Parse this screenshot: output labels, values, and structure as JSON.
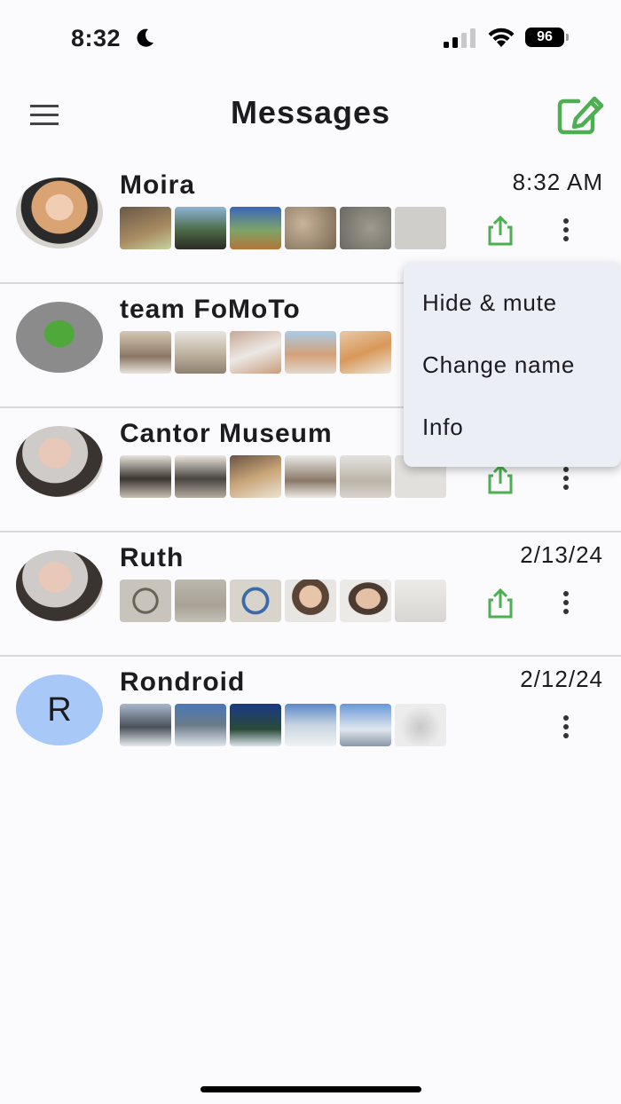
{
  "status": {
    "time": "8:32",
    "battery": "96"
  },
  "header": {
    "title": "Messages"
  },
  "colors": {
    "accent_green": "#4caf50",
    "avatar_letter_bg": "#a8c8f8"
  },
  "conversations": [
    {
      "name": "Moira",
      "time": "8:32 AM",
      "avatar": "photo",
      "share": true
    },
    {
      "name": "team FoMoTo",
      "time": "",
      "avatar": "photo",
      "share": false
    },
    {
      "name": "Cantor Museum",
      "time": "",
      "avatar": "photo",
      "share": true
    },
    {
      "name": "Ruth",
      "time": "2/13/24",
      "avatar": "photo",
      "share": true
    },
    {
      "name": "Rondroid",
      "time": "2/12/24",
      "avatar": "R",
      "share": false
    }
  ],
  "popup_menu": {
    "items": [
      "Hide & mute",
      "Change name",
      "Info"
    ]
  }
}
